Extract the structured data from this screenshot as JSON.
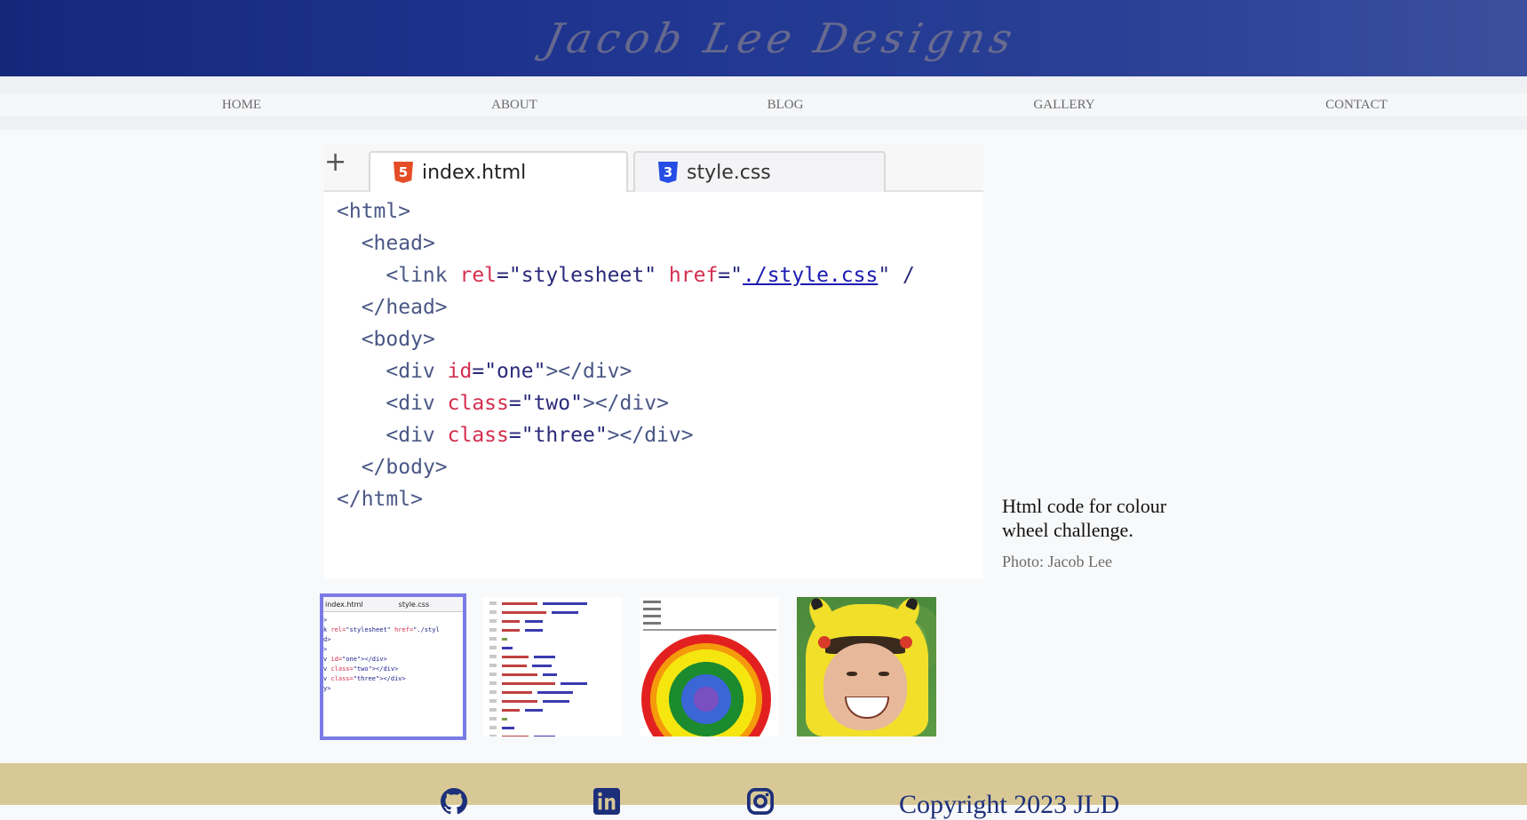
{
  "header": {
    "logo_text": "Jacob Lee Designs"
  },
  "nav": {
    "items": [
      {
        "label": "HOME"
      },
      {
        "label": "ABOUT"
      },
      {
        "label": "BLOG"
      },
      {
        "label": "GALLERY"
      },
      {
        "label": "CONTACT"
      }
    ]
  },
  "main_image": {
    "tabs": [
      {
        "label": "index.html",
        "icon": "html5-icon",
        "active": true
      },
      {
        "label": "style.css",
        "icon": "css3-icon",
        "active": false
      }
    ],
    "new_tab_symbol": "+",
    "code": {
      "html_open": "<html>",
      "head_open": "<head>",
      "link_open": "<link ",
      "link_rel_attr": "rel",
      "link_rel_val": "=\"stylesheet\" ",
      "link_href_attr": "href",
      "link_href_val": "=\"",
      "link_href_url": "./style.css",
      "link_close": "\" /",
      "head_close": "</head>",
      "body_open": "<body>",
      "div_open": "<div ",
      "id_attr": "id",
      "id_val": "=\"one\"",
      "class_attr": "class",
      "class_two_val": "=\"two\"",
      "class_three_val": "=\"three\"",
      "div_close": "></div>",
      "body_close": "</body>",
      "html_close": "</html>"
    }
  },
  "caption": {
    "title": "Html code for colour wheel challenge.",
    "credit": "Photo: Jacob Lee"
  },
  "thumbnails": [
    {
      "kind": "html-code",
      "selected": true,
      "tab_a": "index.html",
      "tab_b": "style.css"
    },
    {
      "kind": "css-code",
      "selected": false
    },
    {
      "kind": "colour-wheel",
      "selected": false
    },
    {
      "kind": "portrait",
      "selected": false
    }
  ],
  "footer": {
    "icons": [
      "github-icon",
      "linkedin-icon",
      "instagram-icon"
    ],
    "copyright": "Copyright 2023 JLD"
  },
  "colors": {
    "header": "#1f3590",
    "footer": "#d8c896",
    "selected_thumb_border": "#7b7be6",
    "copyright": "#1c2f7a"
  }
}
